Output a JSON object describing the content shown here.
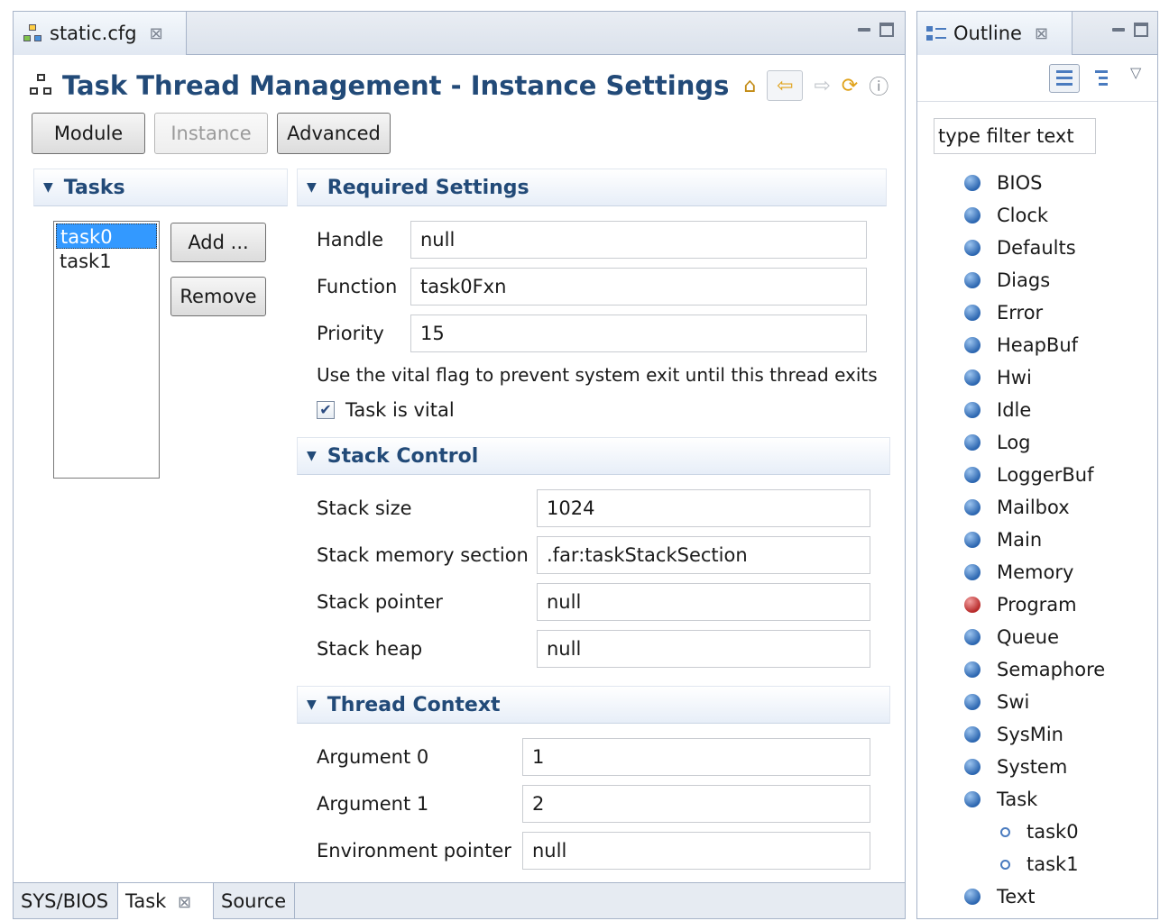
{
  "editor": {
    "tab_label": "static.cfg",
    "title": "Task Thread Management - Instance Settings",
    "buttons": {
      "module": "Module",
      "instance": "Instance",
      "advanced": "Advanced"
    },
    "tasks": {
      "header": "Tasks",
      "items": [
        "task0",
        "task1"
      ],
      "selected": "task0",
      "add_label": "Add ...",
      "remove_label": "Remove"
    },
    "required": {
      "header": "Required Settings",
      "handle_label": "Handle",
      "handle_value": "null",
      "function_label": "Function",
      "function_value": "task0Fxn",
      "priority_label": "Priority",
      "priority_value": "15",
      "vital_note": "Use the vital flag to prevent system exit until this thread exits",
      "vital_label": "Task is vital",
      "vital_checked": true
    },
    "stack": {
      "header": "Stack Control",
      "size_label": "Stack size",
      "size_value": "1024",
      "section_label": "Stack memory section",
      "section_value": ".far:taskStackSection",
      "pointer_label": "Stack pointer",
      "pointer_value": "null",
      "heap_label": "Stack heap",
      "heap_value": "null"
    },
    "context": {
      "header": "Thread Context",
      "arg0_label": "Argument 0",
      "arg0_value": "1",
      "arg1_label": "Argument 1",
      "arg1_value": "2",
      "env_label": "Environment pointer",
      "env_value": "null"
    },
    "bottom_tabs": [
      "SYS/BIOS",
      "Task",
      "Source"
    ]
  },
  "outline": {
    "tab_label": "Outline",
    "filter_placeholder": "type filter text",
    "items": [
      "BIOS",
      "Clock",
      "Defaults",
      "Diags",
      "Error",
      "HeapBuf",
      "Hwi",
      "Idle",
      "Log",
      "LoggerBuf",
      "Mailbox",
      "Main",
      "Memory",
      "Program",
      "Queue",
      "Semaphore",
      "Swi",
      "SysMin",
      "System",
      "Task"
    ],
    "task_children": [
      "task0",
      "task1"
    ],
    "last_item": "Text",
    "error_item": "Program"
  },
  "colors": {
    "title": "#224a78",
    "selection": "#3399ff",
    "module_ball": "#2c66b0",
    "error_ball": "#b72a2a"
  }
}
